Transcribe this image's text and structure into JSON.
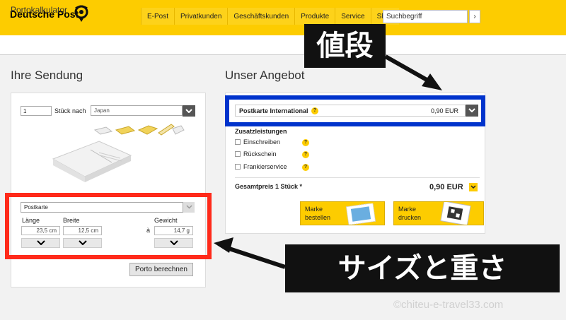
{
  "header": {
    "brand": "Deutsche Post",
    "nav": [
      "E-Post",
      "Privatkunden",
      "Geschäftskunden",
      "Produkte",
      "Service",
      "Shop"
    ],
    "search_placeholder": "Suchbegriff",
    "search_button": "›"
  },
  "page_title": "Portokalkulator",
  "left": {
    "heading": "Ihre Sendung",
    "quantity": "1",
    "quantity_label": "Stück nach",
    "country": "Japan",
    "product": "Postkarte",
    "length_label": "Länge",
    "width_label": "Breite",
    "weight_label": "Gewicht",
    "weight_prefix": "à",
    "length": "23,5 cm",
    "width": "12,5 cm",
    "weight": "14,7 g",
    "porto_button": "Porto berechnen"
  },
  "right": {
    "heading": "Unser Angebot",
    "offer_product": "Postkarte International",
    "offer_price": "0,90 EUR",
    "extras_title": "Zusatzleistungen",
    "extras": [
      "Einschreiben",
      "Rückschein",
      "Frankierservice"
    ],
    "total_label": "Gesamtpreis 1 Stück *",
    "total_price": "0,90 EUR",
    "order_button": "Marke\nbestellen",
    "print_button": "Marke\ndrucken"
  },
  "annotations": {
    "price": "値段",
    "size_weight": "サイズと重さ"
  },
  "watermark": "©chiteu-e-travel33.com",
  "colors": {
    "brand_yellow": "#fdcc00",
    "annotation_blue": "#0033cc",
    "annotation_red": "#ff2a1a"
  },
  "icons": {
    "help": "help-icon",
    "dropdown": "chevron-down-icon"
  }
}
